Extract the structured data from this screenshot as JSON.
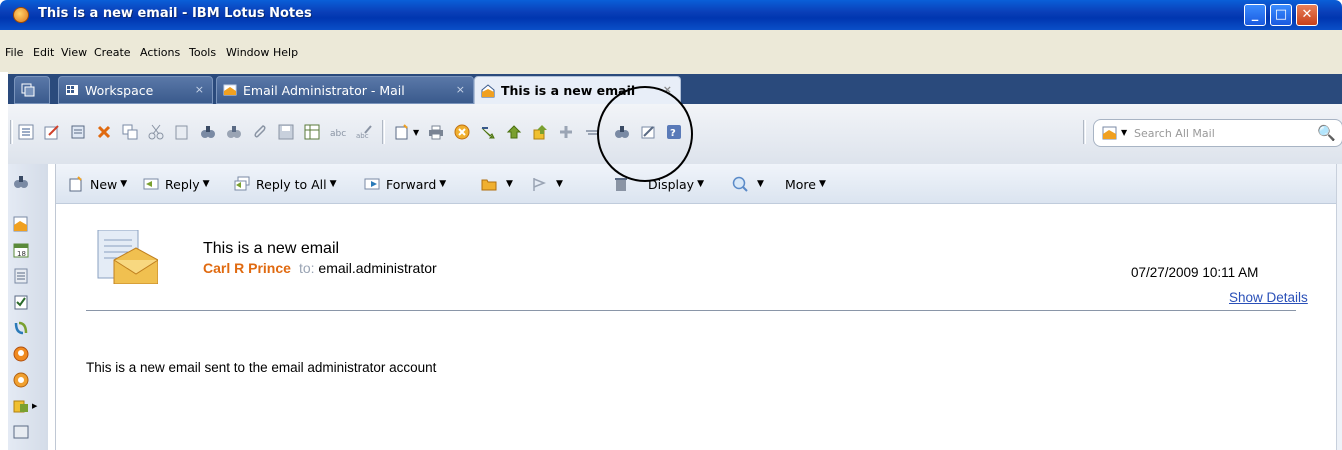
{
  "window": {
    "title": "This is a new email - IBM Lotus Notes"
  },
  "menu": [
    "File",
    "Edit",
    "View",
    "Create",
    "Actions",
    "Tools",
    "Window",
    "Help"
  ],
  "tabs": [
    {
      "label": "Workspace",
      "close": "×"
    },
    {
      "label": "Email Administrator - Mail",
      "close": "×"
    },
    {
      "label": "This is a new email",
      "close": "×"
    }
  ],
  "search": {
    "placeholder": "Search All Mail"
  },
  "actions": {
    "new": "New",
    "reply": "Reply",
    "reply_all": "Reply to All",
    "forward": "Forward",
    "display": "Display",
    "more": "More"
  },
  "email": {
    "subject": "This is a new email",
    "from": "Carl R Prince",
    "to_label": "to:",
    "to": "email.administrator",
    "date": "07/27/2009 10:11 AM",
    "show_details": "Show Details",
    "body": "This is a new email sent to the email administrator account"
  },
  "colors": {
    "title_bar": "#0a3fb8",
    "tab_bar": "#2a4a7c",
    "sender": "#e06a10",
    "link": "#2a50b8"
  }
}
